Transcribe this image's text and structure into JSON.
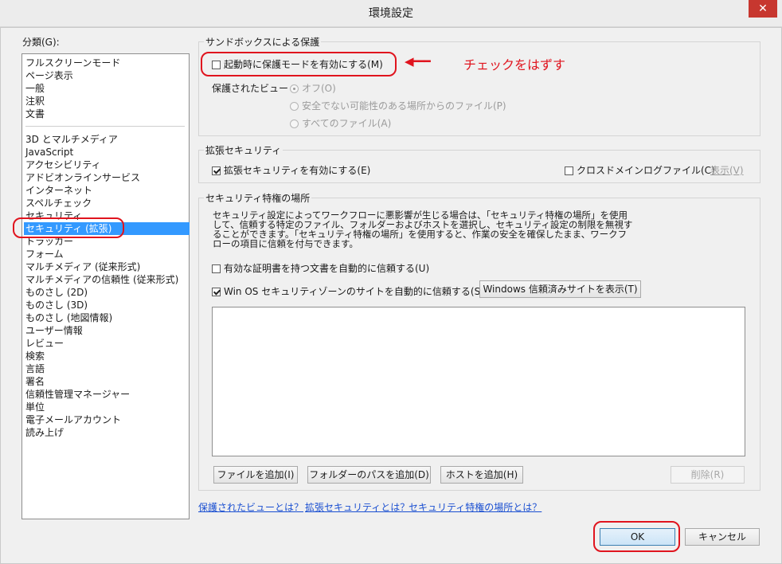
{
  "window": {
    "title": "環境設定",
    "close_label": "✕"
  },
  "sidebar": {
    "label": "分類(G):",
    "items_top": [
      "フルスクリーンモード",
      "ページ表示",
      "一般",
      "注釈",
      "文書"
    ],
    "items": [
      "3D とマルチメディア",
      "JavaScript",
      "アクセシビリティ",
      "アドビオンラインサービス",
      "インターネット",
      "スペルチェック",
      "セキュリティ",
      "セキュリティ (拡張)",
      "トラッカー",
      "フォーム",
      "マルチメディア (従来形式)",
      "マルチメディアの信頼性 (従来形式)",
      "ものさし (2D)",
      "ものさし (3D)",
      "ものさし (地図情報)",
      "ユーザー情報",
      "レビュー",
      "検索",
      "言語",
      "署名",
      "信頼性管理マネージャー",
      "単位",
      "電子メールアカウント",
      "読み上げ"
    ],
    "selected_index": 7
  },
  "sandbox": {
    "title": "サンドボックスによる保護",
    "protected_mode_label": "起動時に保護モードを有効にする(M)",
    "protected_mode_checked": false,
    "protected_view_label": "保護されたビュー",
    "radio_off": "オフ(O)",
    "radio_unsafe": "安全でない可能性のある場所からのファイル(P)",
    "radio_all": "すべてのファイル(A)"
  },
  "annotation": {
    "text": "チェックをはずす",
    "arrow": "◀━━━",
    "color": "#e0141e"
  },
  "enhanced": {
    "title": "拡張セキュリティ",
    "enable_label": "拡張セキュリティを有効にする(E)",
    "enable_checked": true,
    "crossdomain_label": "クロスドメインログファイル(C)",
    "crossdomain_checked": false,
    "view_label": "表示(V)"
  },
  "privileged": {
    "title": "セキュリティ特権の場所",
    "desc1": "セキュリティ設定によってワークフローに悪影響が生じる場合は、「セキュリティ特権の場所」を使用",
    "desc2": "して、信頼する特定のファイル、フォルダーおよびホストを選択し、セキュリティ設定の制限を無視す",
    "desc3": "ることができます。「セキュリティ特権の場所」を使用すると、作業の安全を確保したまま、ワークフ",
    "desc4": "ローの項目に信頼を付与できます。",
    "cert_label": "有効な証明書を持つ文書を自動的に信頼する(U)",
    "cert_checked": false,
    "winos_label": "Win OS セキュリティゾーンのサイトを自動的に信頼する(S)",
    "winos_checked": true,
    "show_sites_button": "Windows 信頼済みサイトを表示(T)",
    "add_file_button": "ファイルを追加(I)",
    "add_folder_button": "フォルダーのパスを追加(D)",
    "add_host_button": "ホストを追加(H)",
    "delete_button": "削除(R)"
  },
  "links": {
    "protected_view": "保護されたビューとは？",
    "enhanced": "拡張セキュリティとは？",
    "privileged": "セキュリティ特権の場所とは？"
  },
  "footer": {
    "ok": "OK",
    "cancel": "キャンセル"
  },
  "colors": {
    "selection": "#3399ff",
    "annotation_red": "#e0141e",
    "link": "#1a4fd1"
  }
}
